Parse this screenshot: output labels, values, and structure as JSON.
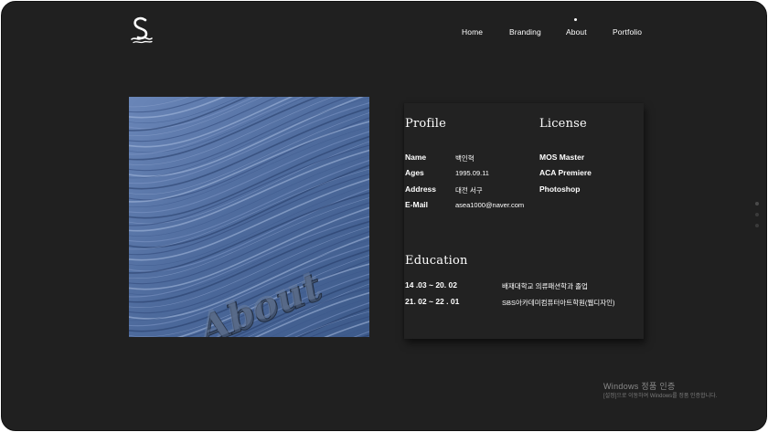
{
  "nav": {
    "items": [
      {
        "label": "Home"
      },
      {
        "label": "Branding"
      },
      {
        "label": "About"
      },
      {
        "label": "Portfolio"
      }
    ],
    "active_index": 2
  },
  "hero": {
    "image_text": "About"
  },
  "profile": {
    "title": "Profile",
    "rows": [
      {
        "label": "Name",
        "value": "백인혁"
      },
      {
        "label": "Ages",
        "value": "1995.09.11"
      },
      {
        "label": "Address",
        "value": "대전 서구"
      },
      {
        "label": "E-Mail",
        "value": "asea1000@naver.com"
      }
    ]
  },
  "license": {
    "title": "License",
    "items": [
      "MOS Master",
      "ACA Premiere",
      "Photoshop"
    ]
  },
  "education": {
    "title": "Education",
    "rows": [
      {
        "period": "14 .03 ~ 20. 02",
        "detail": "배재대학교 의류패션학과 졸업"
      },
      {
        "period": "21. 02 ~ 22 . 01",
        "detail": "SBS아카데미컴퓨터아트학원(웹디자인)"
      }
    ]
  },
  "pager": {
    "count": 3,
    "active_index": 0
  },
  "watermark": {
    "line1": "Windows 정품 인증",
    "line2": "[설정]으로 이동하여 Windows를 정품 인증합니다."
  },
  "colors": {
    "background": "#202020",
    "card": "#222222",
    "text": "#ffffff",
    "hero_blue": "#5a78a8"
  }
}
